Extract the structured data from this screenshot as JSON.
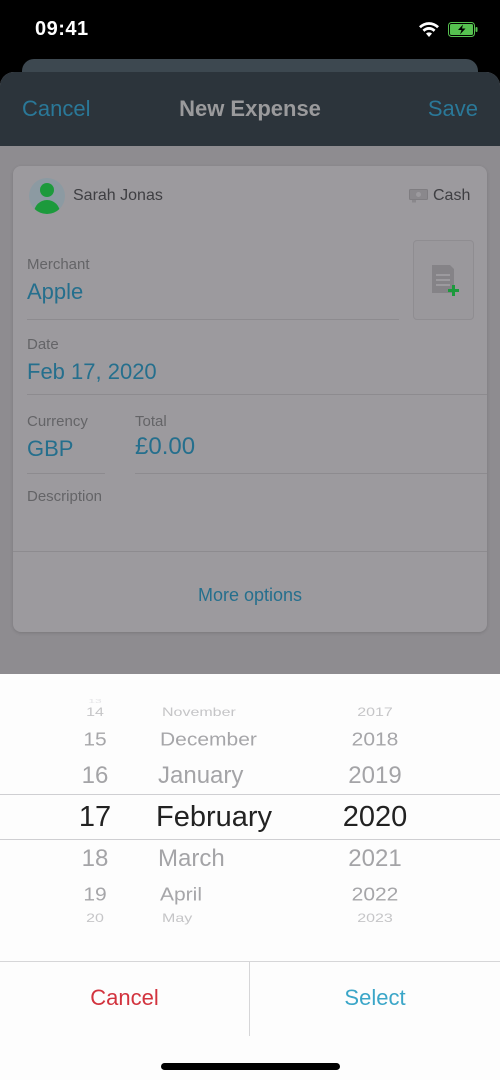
{
  "status_bar": {
    "time": "09:41",
    "icons": [
      "wifi-icon",
      "battery-charging-icon"
    ]
  },
  "nav": {
    "cancel_label": "Cancel",
    "title": "New Expense",
    "save_label": "Save"
  },
  "form": {
    "user_name": "Sarah Jonas",
    "payment_method": "Cash",
    "merchant": {
      "label": "Merchant",
      "value": "Apple"
    },
    "date": {
      "label": "Date",
      "value": "Feb 17, 2020"
    },
    "currency": {
      "label": "Currency",
      "value": "GBP"
    },
    "total": {
      "label": "Total",
      "value": "£0.00"
    },
    "description": {
      "label": "Description",
      "value": ""
    },
    "more_options_label": "More options",
    "add_receipt_icon": "receipt-add-icon"
  },
  "date_picker": {
    "days": [
      "14",
      "15",
      "16",
      "17",
      "18",
      "19",
      "20"
    ],
    "months": [
      "November",
      "December",
      "January",
      "February",
      "March",
      "April",
      "May"
    ],
    "years": [
      "2017",
      "2018",
      "2019",
      "2020",
      "2021",
      "2022",
      "2023"
    ],
    "selected": {
      "day": "17",
      "month": "February",
      "year": "2020"
    },
    "cancel_label": "Cancel",
    "select_label": "Select"
  },
  "colors": {
    "accent": "#3ba6c8",
    "destructive": "#d2333e",
    "avatar_green": "#1c9a3c"
  }
}
